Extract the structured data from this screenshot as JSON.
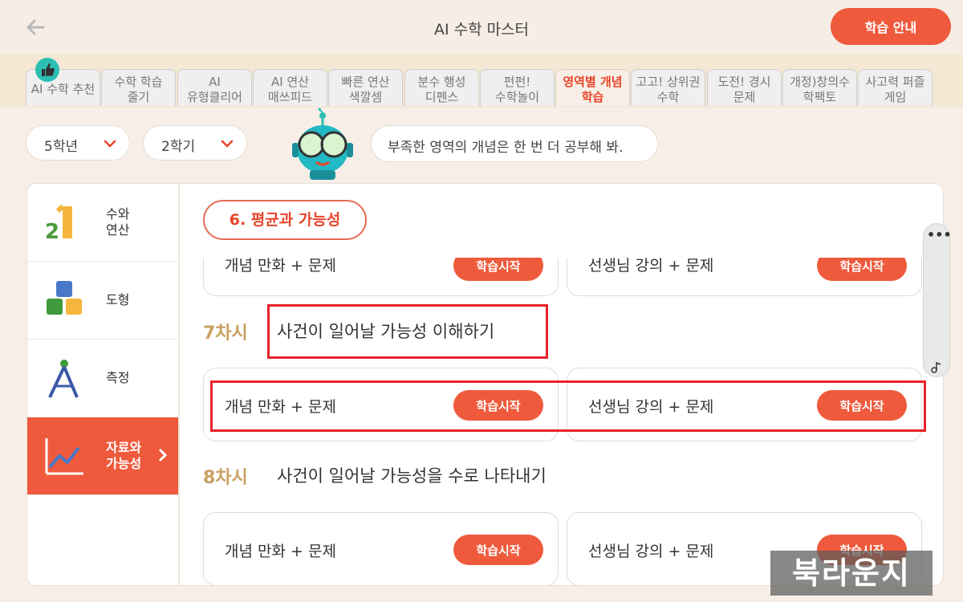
{
  "header": {
    "title": "AI 수학 마스터",
    "guide_button": "학습 안내"
  },
  "tabs": [
    {
      "label": "AI 수학 추천",
      "active": false
    },
    {
      "label": "수학 학습\n줄기",
      "active": false
    },
    {
      "label": "AI\n유형클리어",
      "active": false
    },
    {
      "label": "AI 연산\n매쓰피드",
      "active": false
    },
    {
      "label": "빠른 연산\n색깔셈",
      "active": false
    },
    {
      "label": "분수 행성\n디펜스",
      "active": false
    },
    {
      "label": "펀펀!\n수학놀이",
      "active": false
    },
    {
      "label": "영역별 개념\n학습",
      "active": true
    },
    {
      "label": "고고! 상위권\n수학",
      "active": false
    },
    {
      "label": "도전! 경시\n문제",
      "active": false
    },
    {
      "label": "개정)창의수\n학팩토",
      "active": false
    },
    {
      "label": "사고력 퍼즐\n게임",
      "active": false
    }
  ],
  "filters": {
    "grade": "5학년",
    "semester": "2학기"
  },
  "mascot_message": "부족한 영역의 개념은 한 번 더 공부해 봐.",
  "sidebar": [
    {
      "label": "수와\n연산",
      "icon": "number-blocks-icon",
      "active": false
    },
    {
      "label": "도형",
      "icon": "cubes-icon",
      "active": false
    },
    {
      "label": "측정",
      "icon": "compass-icon",
      "active": false
    },
    {
      "label": "자료와\n가능성",
      "icon": "line-chart-icon",
      "active": true
    }
  ],
  "unit_title": "6. 평균과 가능성",
  "cards_common": {
    "comic_label": "개념 만화 + 문제",
    "lecture_label": "선생님 강의 + 문제",
    "start_label": "학습시작"
  },
  "sessions": [
    {
      "number": "7차시",
      "title": "사건이 일어날 가능성 이해하기"
    },
    {
      "number": "8차시",
      "title": "사건이 일어날 가능성을 수로 나타내기"
    }
  ],
  "scroll": {
    "dots": "•••"
  },
  "watermark": "북라운지",
  "colors": {
    "accent": "#ef5a3c",
    "active_tab_text": "#e8452a",
    "session_number": "#c9a060",
    "highlight_box": "#e8222a"
  }
}
